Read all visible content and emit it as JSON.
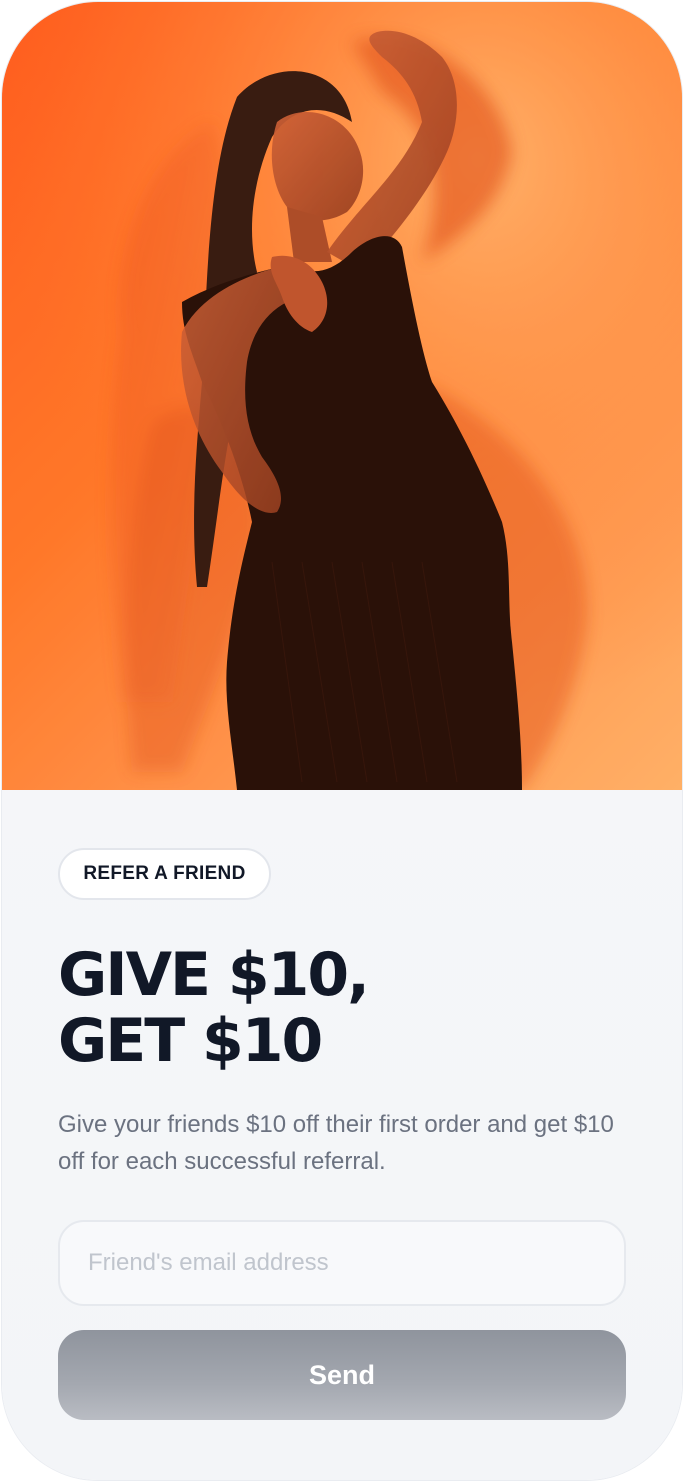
{
  "hero": {
    "image_name": "woman-orange-backdrop-photo",
    "accent_colors": [
      "#ff5b1f",
      "#ff9b54",
      "#ffb86f"
    ]
  },
  "referral": {
    "badge_label": "REFER A FRIEND",
    "headline_line1": "GIVE $10,",
    "headline_line2": "GET $10",
    "description": "Give your friends $10 off their first order and get $10 off for each successful referral."
  },
  "form": {
    "email": {
      "placeholder": "Friend's email address",
      "value": ""
    },
    "send_label": "Send"
  },
  "colors": {
    "text_primary": "#111827",
    "text_secondary": "#6b7280",
    "button_gray": "#9a9ea6"
  }
}
